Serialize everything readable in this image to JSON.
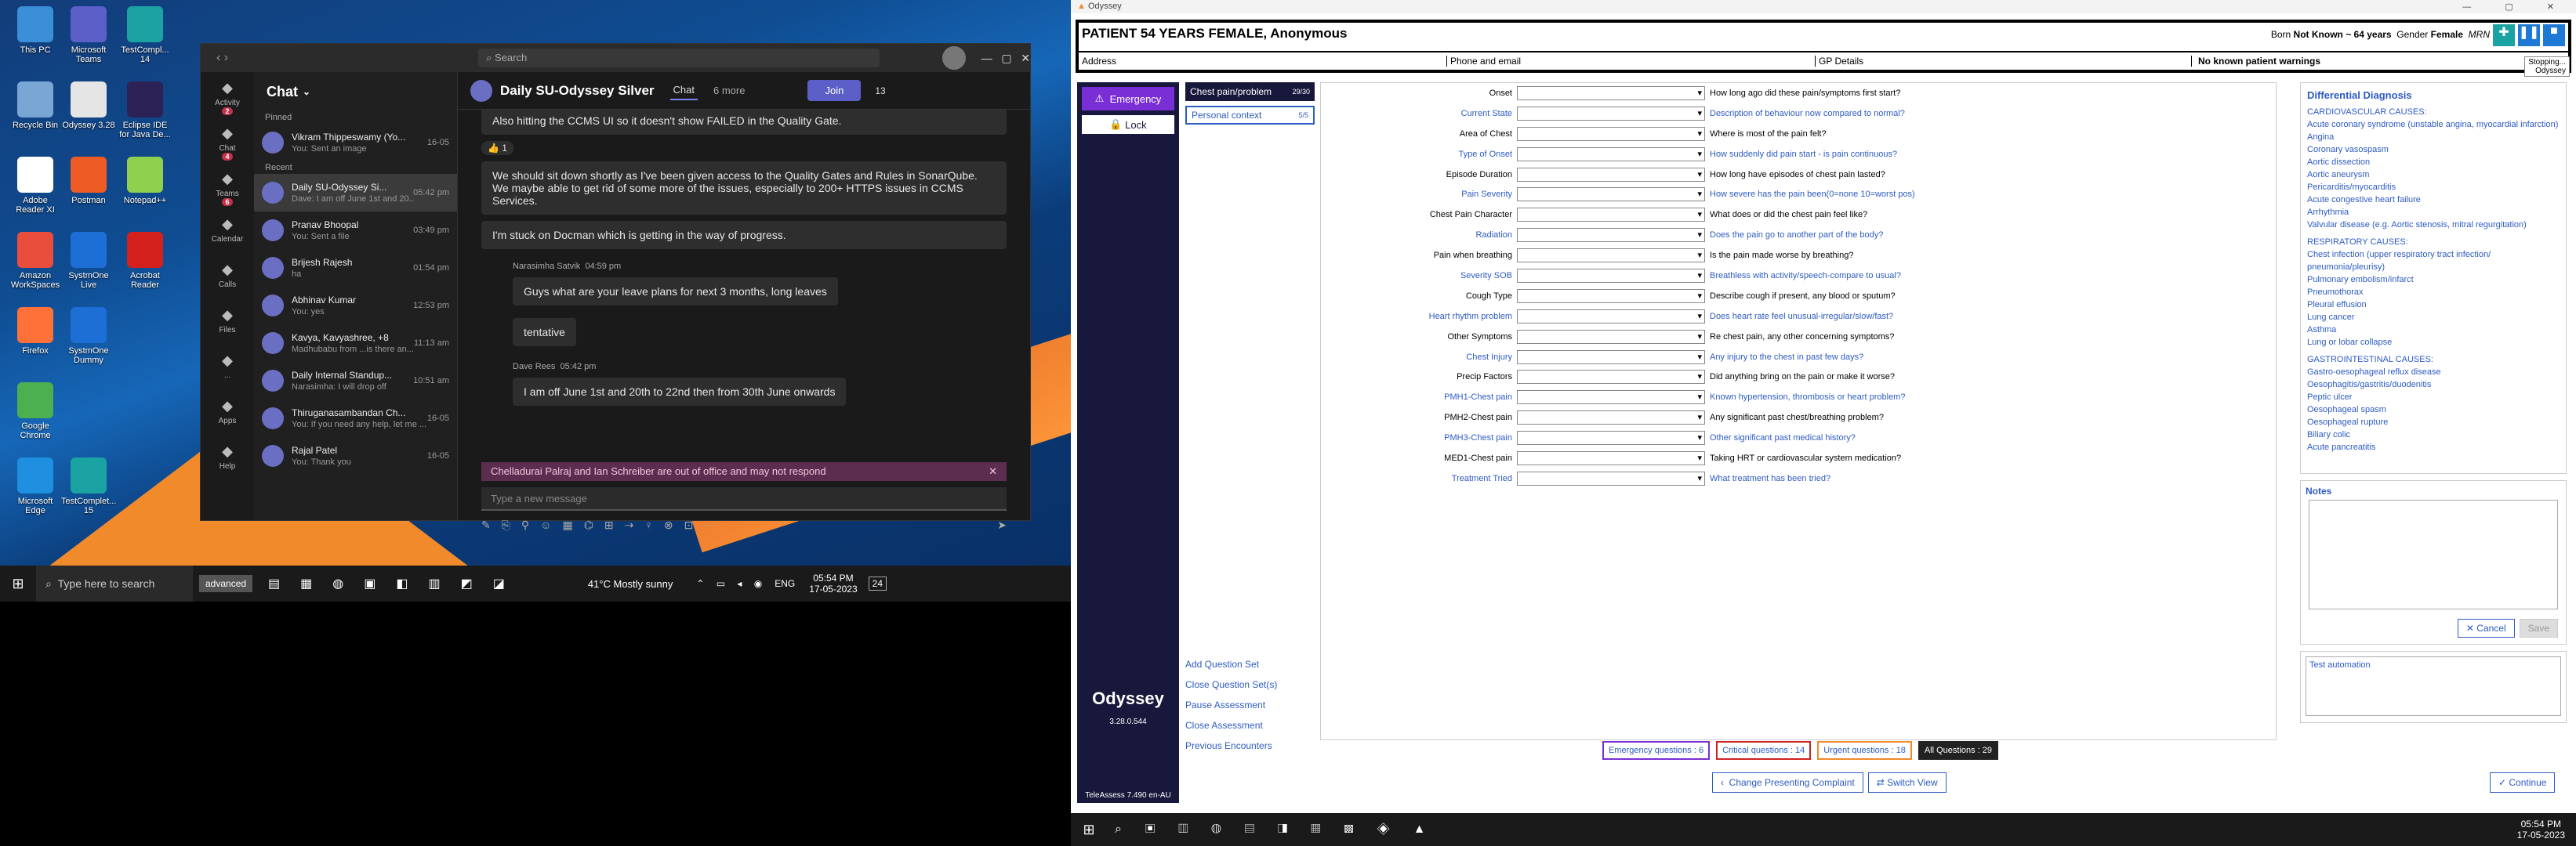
{
  "left_screen": {
    "desktop_icons": [
      {
        "label": "This PC",
        "icon": "pc-icon",
        "color": "#3b8ed8"
      },
      {
        "label": "Microsoft Teams",
        "icon": "teams-icon",
        "color": "#5b5fc7"
      },
      {
        "label": "TestCompl... 14",
        "icon": "testcomplete-icon",
        "color": "#1ba3a3"
      },
      {
        "label": "Recycle Bin",
        "icon": "recycle-bin-icon",
        "color": "#7aa6d6"
      },
      {
        "label": "Odyssey 3.28",
        "icon": "odyssey-icon",
        "color": "#e5e5e5"
      },
      {
        "label": "Eclipse IDE for Java De...",
        "icon": "eclipse-icon",
        "color": "#2c2255"
      },
      {
        "label": "Adobe Reader XI",
        "icon": "pdf-icon",
        "color": "#ffffff"
      },
      {
        "label": "Postman",
        "icon": "postman-icon",
        "color": "#ef5b25"
      },
      {
        "label": "Notepad++",
        "icon": "notepad-icon",
        "color": "#8fd14f"
      },
      {
        "label": "Amazon WorkSpaces",
        "icon": "workspaces-icon",
        "color": "#e94e3c"
      },
      {
        "label": "SystmOne Live",
        "icon": "systmone-icon",
        "color": "#1d6fd6"
      },
      {
        "label": "Acrobat Reader",
        "icon": "acrobat-icon",
        "color": "#d4201c"
      },
      {
        "label": "Firefox",
        "icon": "firefox-icon",
        "color": "#ff7139"
      },
      {
        "label": "SystmOne Dummy",
        "icon": "systmone-icon",
        "color": "#1d6fd6"
      },
      {
        "label": "Google Chrome",
        "icon": "chrome-icon",
        "color": "#4caf50"
      },
      {
        "label": "Microsoft Edge",
        "icon": "edge-icon",
        "color": "#1f8fe0"
      },
      {
        "label": "TestComplet... 15",
        "icon": "testcomplete-icon",
        "color": "#1ba3a3"
      }
    ],
    "teams": {
      "search_placeholder": "Search",
      "rail": [
        {
          "label": "Activity",
          "badge": "2"
        },
        {
          "label": "Chat",
          "badge": "4"
        },
        {
          "label": "Teams",
          "badge": "6"
        },
        {
          "label": "Calendar"
        },
        {
          "label": "Calls"
        },
        {
          "label": "Files"
        },
        {
          "label": "..."
        },
        {
          "label": "Apps"
        },
        {
          "label": "Help"
        }
      ],
      "chat_title": "Chat",
      "pinned_label": "Pinned",
      "recent_label": "Recent",
      "pinned": [
        {
          "name": "Vikram Thippeswamy (Yo...",
          "preview": "You: Sent an image",
          "time": "16-05"
        }
      ],
      "recent": [
        {
          "name": "Daily SU-Odyssey Si...",
          "preview": "Dave: I am off June 1st and 20...",
          "time": "05:42 pm"
        },
        {
          "name": "Pranav Bhoopal",
          "preview": "You: Sent a file",
          "time": "03:49 pm"
        },
        {
          "name": "Brijesh Rajesh",
          "preview": "ha",
          "time": "01:54 pm"
        },
        {
          "name": "Abhinav Kumar",
          "preview": "You: yes",
          "time": "12:53 pm"
        },
        {
          "name": "Kavya, Kavyashree, +8",
          "preview": "Madhubabu from ...is there an...",
          "time": "11:13 am"
        },
        {
          "name": "Daily Internal Standup...",
          "preview": "Narasimha: I will drop off",
          "time": "10:51 am"
        },
        {
          "name": "Thiruganasambandan Ch...",
          "preview": "You: If you need any help, let me ...",
          "time": "16-05"
        },
        {
          "name": "Rajal Patel",
          "preview": "You: Thank you",
          "time": "16-05"
        }
      ],
      "conv_title": "Daily SU-Odyssey Silver",
      "conv_tab": "Chat",
      "more_label": "6 more",
      "join_label": "Join",
      "people_count": "13",
      "messages": [
        {
          "text": "Also hitting the CCMS UI so it doesn't show FAILED in the Quality Gate."
        },
        {
          "text": "We should sit down shortly as I've been given access to the Quality Gates and Rules in SonarQube. We maybe able to get rid of some more of the issues, especially to 200+ HTTPS issues in CCMS Services."
        },
        {
          "text": "I'm stuck on Docman which is getting in the way of progress."
        }
      ],
      "msg2_author": "Narasimha Satvik",
      "msg2_time": "04:59 pm",
      "msg2_texts": [
        "Guys what are your leave plans for next 3 months, long leaves",
        "tentative"
      ],
      "msg3_author": "Dave Rees",
      "msg3_time": "05:42 pm",
      "msg3_text": "I am off June 1st and 20th to 22nd then from 30th June onwards",
      "ooo_banner": "Chelladurai Palraj and Ian Schreiber are out of office and may not respond",
      "compose_placeholder": "Type a new message",
      "reaction": "1"
    },
    "taskbar": {
      "search_placeholder": "Type here to search",
      "advanced_label": "advanced",
      "weather": "41°C  Mostly sunny",
      "lang": "ENG",
      "time": "05:54 PM",
      "date": "17-05-2023",
      "notif": "24"
    }
  },
  "odyssey": {
    "window_title": "Odyssey",
    "patient_header": "PATIENT 54 YEARS FEMALE, Anonymous",
    "born_label": "Born",
    "born_value": "Not Known ~ 64 years",
    "gender_label": "Gender",
    "gender_value": "Female",
    "mrn_label": "MRN",
    "address_label": "Address",
    "phone_label": "Phone and email",
    "gp_label": "GP Details",
    "warnings": "No known patient warnings",
    "tooltip_stop": "Stopping...",
    "tooltip_app": "Odyssey",
    "emergency_label": "Emergency",
    "lock_label": "Lock",
    "brand": "Odyssey",
    "version": "3.28.0.544",
    "teleassess": "TeleAssess 7.490 en-AU",
    "question_sets": [
      {
        "label": "Chest pain/problem",
        "count": "29/30"
      },
      {
        "label": "Personal context",
        "count": "5/5"
      }
    ],
    "links": [
      "Add Question Set",
      "Close Question Set(s)",
      "Pause Assessment",
      "Close Assessment",
      "Previous Encounters"
    ],
    "questions": [
      {
        "label": "Onset",
        "q": "How long ago did these pain/symptoms first start?",
        "blue": false
      },
      {
        "label": "Current State",
        "q": "Description of behaviour now compared to normal?",
        "blue": true
      },
      {
        "label": "Area of Chest",
        "q": "Where is most of the pain felt?",
        "blue": false
      },
      {
        "label": "Type of Onset",
        "q": "How suddenly did pain start - is pain continuous?",
        "blue": true
      },
      {
        "label": "Episode Duration",
        "q": "How long have episodes of chest pain lasted?",
        "blue": false
      },
      {
        "label": "Pain Severity",
        "q": "How severe has the pain been(0=none 10=worst pos)",
        "blue": true
      },
      {
        "label": "Chest Pain Character",
        "q": "What does or did the chest pain feel like?",
        "blue": false
      },
      {
        "label": "Radiation",
        "q": "Does the pain go to another part of the body?",
        "blue": true
      },
      {
        "label": "Pain when breathing",
        "q": "Is the pain made worse by breathing?",
        "blue": false
      },
      {
        "label": "Severity SOB",
        "q": "Breathless with activity/speech-compare to usual?",
        "blue": true
      },
      {
        "label": "Cough Type",
        "q": "Describe cough if present, any blood or sputum?",
        "blue": false
      },
      {
        "label": "Heart rhythm problem",
        "q": "Does heart rate feel unusual-irregular/slow/fast?",
        "blue": true
      },
      {
        "label": "Other Symptoms",
        "q": "Re chest pain, any other concerning symptoms?",
        "blue": false
      },
      {
        "label": "Chest Injury",
        "q": "Any injury to the chest in past few days?",
        "blue": true
      },
      {
        "label": "Precip Factors",
        "q": "Did anything bring on the pain or make it worse?",
        "blue": false
      },
      {
        "label": "PMH1-Chest pain",
        "q": "Known hypertension, thrombosis or heart problem?",
        "blue": true
      },
      {
        "label": "PMH2-Chest pain",
        "q": "Any significant past chest/breathing problem?",
        "blue": false
      },
      {
        "label": "PMH3-Chest pain",
        "q": "Other significant past medical history?",
        "blue": true
      },
      {
        "label": "MED1-Chest pain",
        "q": "Taking HRT or cardiovascular system medication?",
        "blue": false
      },
      {
        "label": "Treatment Tried",
        "q": "What treatment has been tried?",
        "blue": true
      }
    ],
    "dx_title": "Differential Diagnosis",
    "dx": [
      {
        "head": "CARDIOVASCULAR CAUSES:"
      },
      {
        "t": "Acute coronary syndrome (unstable angina, myocardial infarction)"
      },
      {
        "t": "Angina"
      },
      {
        "t": "Coronary vasospasm"
      },
      {
        "t": "Aortic dissection"
      },
      {
        "t": "Aortic aneurysm"
      },
      {
        "t": "Pericarditis/myocarditis"
      },
      {
        "t": "Acute congestive heart failure"
      },
      {
        "t": "Arrhythmia"
      },
      {
        "t": "Valvular disease (e.g. Aortic stenosis, mitral regurgitation)"
      },
      {
        "head": "RESPIRATORY CAUSES:"
      },
      {
        "t": "Chest infection (upper respiratory tract infection/ pneumonia/pleurisy)"
      },
      {
        "t": "Pulmonary embolism/infarct"
      },
      {
        "t": "Pneumothorax"
      },
      {
        "t": "Pleural effusion"
      },
      {
        "t": "Lung cancer"
      },
      {
        "t": "Asthma"
      },
      {
        "t": "Lung or lobar collapse"
      },
      {
        "head": "GASTROINTESTINAL CAUSES:"
      },
      {
        "t": "Gastro-oesophageal reflux disease"
      },
      {
        "t": "Oesophagitis/gastritis/duodenitis"
      },
      {
        "t": "Peptic ulcer"
      },
      {
        "t": "Oesophageal spasm"
      },
      {
        "t": "Oesophageal rupture"
      },
      {
        "t": "Biliary colic"
      },
      {
        "t": "Acute pancreatitis"
      }
    ],
    "notes_title": "Notes",
    "cancel_label": "Cancel",
    "save_label": "Save",
    "automation_text": "Test automation",
    "counters": [
      {
        "label": "Emergency questions : 6",
        "color": "#7a2fd6"
      },
      {
        "label": "Critical questions : 14",
        "color": "#d12020"
      },
      {
        "label": "Urgent questions : 18",
        "color": "#f08a2a"
      },
      {
        "label": "All Questions : 29",
        "color": "#222222"
      }
    ],
    "change_label": "Change Presenting Complaint",
    "switch_label": "Switch View",
    "continue_label": "Continue",
    "taskbar_time": "05:54 PM",
    "taskbar_date": "17-05-2023"
  }
}
